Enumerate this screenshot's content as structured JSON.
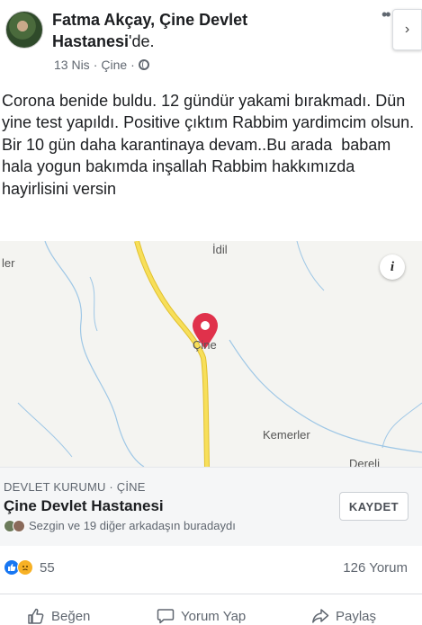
{
  "post": {
    "author": "Fatma Akçay",
    "location_name": "Çine Devlet Hastanesi",
    "location_prefix": ", ",
    "location_suffix": "'de.",
    "date": "13 Nis",
    "place": "Çine",
    "text": "Corona benide buldu. 12 gündür yakami bırakmadı. Dün yine test yapıldı. Positive çıktım Rabbim yardimcim olsun. Bir 10 gün daha karantinaya devam..Bu arada  babam hala yogun bakımda inşallah Rabbim hakkımızda hayirlisini versin"
  },
  "map": {
    "labels": {
      "idil": "İdil",
      "ler": "ler",
      "cine": "Çine",
      "kemerler": "Kemerler",
      "dereli": "Dereli"
    },
    "info_icon": "i"
  },
  "place_card": {
    "category": "DEVLET KURUMU · ÇİNE",
    "name": "Çine Devlet Hastanesi",
    "visitors": "Sezgin ve 19 diğer arkadaşın buradaydı",
    "save_label": "KAYDET"
  },
  "reactions": {
    "count": "55",
    "comments": "126 Yorum"
  },
  "actions": {
    "like": "Beğen",
    "comment": "Yorum Yap",
    "share": "Paylaş"
  },
  "colors": {
    "road": "#f2d44e",
    "pin": "#e0314b",
    "like_blue": "#1877f2"
  }
}
